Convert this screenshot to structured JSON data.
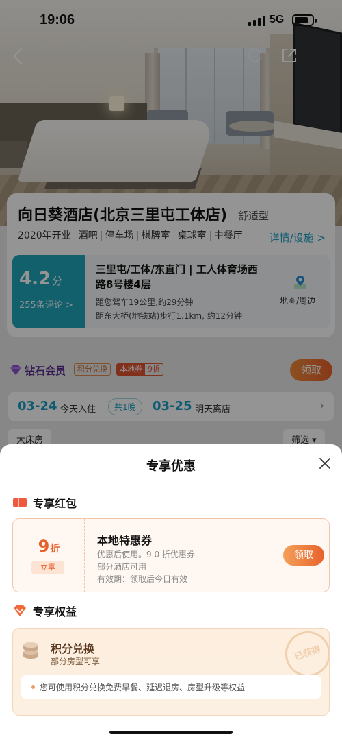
{
  "status": {
    "time": "19:06",
    "network": "5G"
  },
  "hotel": {
    "name": "向日葵酒店(北京三里屯工体店)",
    "type": "舒适型",
    "tags": [
      "2020年开业",
      "酒吧",
      "停车场",
      "棋牌室",
      "桌球室",
      "中餐厅"
    ],
    "detail_link": "详情/设施 >",
    "score": "4.2",
    "score_unit": "分",
    "reviews": "255条评论 >",
    "address": "三里屯/工体/东直门 | 工人体育场西路8号楼4层",
    "distance_drive": "距您驾车19公里,约29分钟",
    "distance_subway": "距东大桥(地铁站)步行1.1km, 约12分钟",
    "map_label": "地图/周边"
  },
  "member": {
    "title": "钻石会员",
    "tag_points": "积分兑换",
    "tag_local": "本地券",
    "tag_local_value": "9折",
    "claim": "领取"
  },
  "dates": {
    "checkin": "03-24",
    "checkin_label": "今天入住",
    "nights": "共1晚",
    "checkout": "03-25",
    "checkout_label": "明天离店"
  },
  "room_tab": "大床房",
  "filter": "筛选 ▾",
  "sheet": {
    "title": "专享优惠",
    "section_coupon": "专享红包",
    "section_perks": "专享权益",
    "coupon": {
      "discount": "9",
      "discount_unit": "折",
      "instant": "立享",
      "title": "本地特惠券",
      "line1": "优惠后使用。9.0 折优惠券",
      "line2": "部分酒店可用",
      "line3": "有效期：领取后今日有效",
      "claim": "领取"
    },
    "perk": {
      "title": "积分兑换",
      "subtitle": "部分房型可享",
      "stamp": "已获得",
      "note": "您可使用积分兑换免费早餐、延迟退房、房型升级等权益"
    }
  },
  "colors": {
    "accent": "#1a9fc5",
    "orange": "#e8622c"
  }
}
